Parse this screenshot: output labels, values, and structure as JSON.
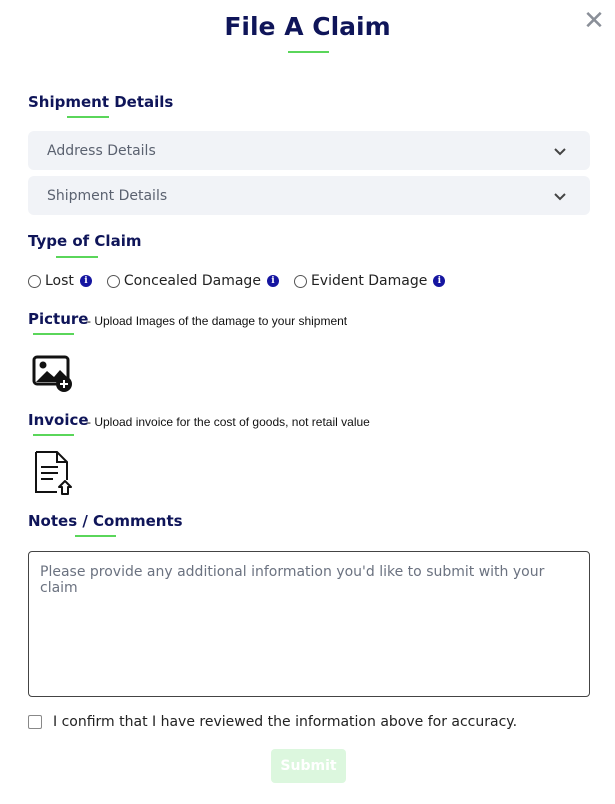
{
  "modal": {
    "title": "File A Claim",
    "close_icon": "close-icon",
    "accent_color": "#5ad65a",
    "heading_color": "#0f1559"
  },
  "shipment": {
    "heading": "Shipment Details",
    "accordions": [
      {
        "label": "Address Details",
        "icon": "chevron-down-icon"
      },
      {
        "label": "Shipment Details",
        "icon": "chevron-down-icon"
      }
    ]
  },
  "claim_type": {
    "heading": "Type of Claim",
    "options": [
      {
        "label": "Lost",
        "info_icon": "info-icon"
      },
      {
        "label": "Concealed Damage",
        "info_icon": "info-icon"
      },
      {
        "label": "Evident Damage",
        "info_icon": "info-icon"
      }
    ]
  },
  "picture": {
    "heading": "Picture",
    "hint": "- Upload Images of the damage to your shipment",
    "icon": "add-image-icon"
  },
  "invoice": {
    "heading": "Invoice",
    "hint": "- Upload invoice for the cost of goods, not retail value",
    "icon": "upload-document-icon"
  },
  "notes": {
    "heading": "Notes / Comments",
    "placeholder": "Please provide any additional information you'd like to submit with your claim",
    "value": ""
  },
  "confirm": {
    "label": "I confirm that I have reviewed the information above for accuracy."
  },
  "submit": {
    "label": "Submit",
    "color": "#dcf7de"
  }
}
